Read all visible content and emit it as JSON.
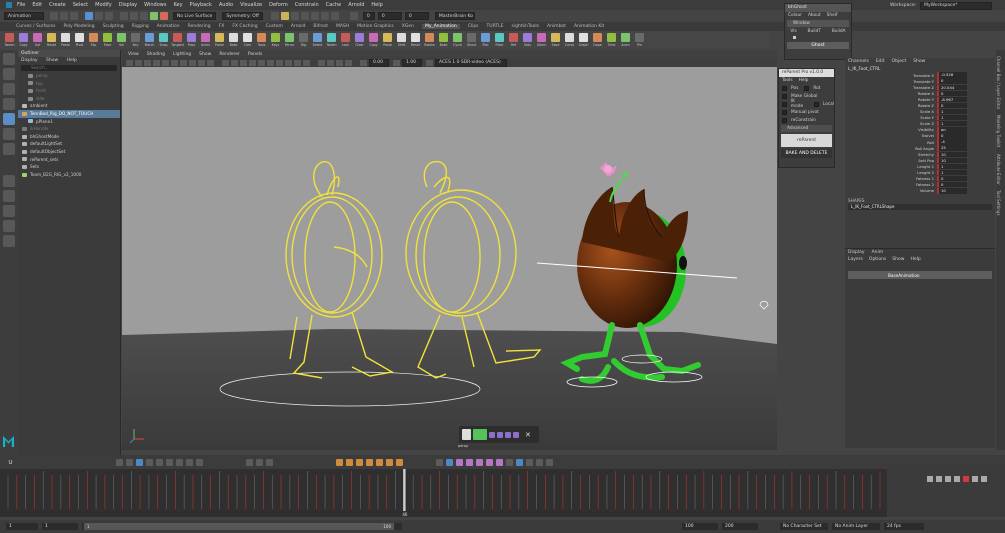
{
  "menubar": {
    "items": [
      "File",
      "Edit",
      "Create",
      "Select",
      "Modify",
      "Display",
      "Windows",
      "Key",
      "Playback",
      "Audio",
      "Visualize",
      "Deform",
      "Constrain",
      "Cache",
      "Arnold",
      "Help"
    ]
  },
  "statusline": {
    "mode": "Animation",
    "live_surface": "No Live Surface",
    "symmetry": "Symmetry: Off",
    "camera": "MasterBrain Ko",
    "frame_a": "0",
    "frame_b": "0",
    "frame_c": "0"
  },
  "workspace": {
    "label": "Workspace:",
    "value": "MyWorkspace*"
  },
  "shelf": {
    "tabs": [
      "Curves / Surfaces",
      "Poly Modeling",
      "Sculpting",
      "Rigging",
      "Animation",
      "Rendering",
      "FX",
      "FX Caching",
      "Custom",
      "Arnold",
      "Bifrost",
      "MASH",
      "Motion Graphics",
      "XGen",
      "My_Animation",
      "Clips",
      "TURTLE",
      "sightlinTools",
      "Animbot",
      "Animation Kit"
    ],
    "active_tab": "My_Animation",
    "buttons": [
      "Tween",
      "Copy",
      "Gof",
      "Reset",
      "Paste",
      "Pivot",
      "Flip",
      "Pose",
      "Sel",
      "Key",
      "Match",
      "Snap",
      "Tangent",
      "Pose",
      "Animi",
      "Polish",
      "Bake",
      "Cam",
      "Tools",
      "Keys",
      "Mirror",
      "Rig",
      "Select",
      "Tween",
      "Lock",
      "Clear",
      "Copy",
      "Paste",
      "Shift",
      "Reset",
      "Rotate",
      "Bake",
      "Cycle",
      "Ghost",
      "Plot",
      "Filter",
      "Ref",
      "Sets",
      "Xform",
      "Save",
      "Curve",
      "Graph",
      "Dope",
      "Time",
      "Anim",
      "Pin"
    ]
  },
  "outliner": {
    "title": "Outliner",
    "menu": [
      "Display",
      "Show",
      "Help"
    ],
    "search_placeholder": "Search...",
    "items": [
      {
        "label": "persp",
        "dim": true,
        "color": "#8a8a8a"
      },
      {
        "label": "top",
        "dim": true,
        "color": "#8a8a8a"
      },
      {
        "label": "front",
        "dim": true,
        "color": "#8a8a8a"
      },
      {
        "label": "side",
        "dim": true,
        "color": "#8a8a8a"
      },
      {
        "label": "ambient",
        "dim": false,
        "color": "#b8b8b8"
      },
      {
        "label": "TennBod_Rig_DO_NOT_TOUCH",
        "dim": false,
        "color": "#d6a55a",
        "selected": true
      },
      {
        "label": "pPlane1",
        "dim": false,
        "color": "#8fbce0"
      },
      {
        "label": "ikHandle",
        "dim": true,
        "color": "#7a7a7a"
      },
      {
        "label": "bhGhostMode",
        "dim": false,
        "color": "#b0b0b0"
      },
      {
        "label": "defaultLightSet",
        "dim": false,
        "color": "#b0b0b0"
      },
      {
        "label": "defaultObjectSet",
        "dim": false,
        "color": "#b0b0b0"
      },
      {
        "label": "reParent_sets",
        "dim": false,
        "color": "#b0b0b0"
      },
      {
        "label": "Sets",
        "dim": false,
        "color": "#b0b0b0"
      },
      {
        "label": "Team_B2G_RIG_v2_1000",
        "dim": false,
        "color": "#9bd26b"
      }
    ]
  },
  "viewport": {
    "menu": [
      "View",
      "Shading",
      "Lighting",
      "Show",
      "Renderer",
      "Panels"
    ],
    "exposure": "0.00",
    "gamma": "1.00",
    "color_space": "ACES 1.0 SDR-video (ACES)",
    "camera_label": "persp"
  },
  "pose_widget": {
    "label": "persp"
  },
  "channel_box": {
    "menu": [
      "Channels",
      "Edit",
      "Object",
      "Show"
    ],
    "object": "L_IK_Foot_CTRL",
    "attrs": [
      {
        "name": "Translate X",
        "value": "-0.528"
      },
      {
        "name": "Translate Y",
        "value": "0"
      },
      {
        "name": "Translate Z",
        "value": "20.044"
      },
      {
        "name": "Rotate X",
        "value": "0"
      },
      {
        "name": "Rotate Y",
        "value": "-8.967"
      },
      {
        "name": "Rotate Z",
        "value": "0"
      },
      {
        "name": "Scale X",
        "value": "1"
      },
      {
        "name": "Scale Y",
        "value": "1"
      },
      {
        "name": "Scale Z",
        "value": "1"
      },
      {
        "name": "Visibility",
        "value": "on"
      },
      {
        "name": "Swivel",
        "value": "0"
      },
      {
        "name": "Roll",
        "value": "-4"
      },
      {
        "name": "Roll Angle",
        "value": "25"
      },
      {
        "name": "Stretchy",
        "value": "10"
      },
      {
        "name": "Anti Pop",
        "value": "10"
      },
      {
        "name": "Lenght 1",
        "value": "1"
      },
      {
        "name": "Lenght 2",
        "value": "1"
      },
      {
        "name": "Fatness 1",
        "value": "0"
      },
      {
        "name": "Fatness 2",
        "value": "0"
      },
      {
        "name": "Volume",
        "value": "10"
      }
    ],
    "shapes_label": "SHAPES",
    "shape": "L_IK_Foot_CTRLShape"
  },
  "layer_editor": {
    "tabs": [
      "Display",
      "Anim"
    ],
    "menu": [
      "Layers",
      "Options",
      "Show",
      "Help"
    ],
    "layer": "BaseAnimation"
  },
  "right_tabs": [
    "Channel Box / Layer Editor",
    "Modeling Toolkit",
    "Attribute Editor",
    "Tool Settings"
  ],
  "win_tools": {
    "title": "bhGhost",
    "menu": [
      "Colour",
      "About",
      "Shelf"
    ],
    "row": "Window",
    "buttons": [
      "Vis",
      "BuildT",
      "BuildA"
    ],
    "ghost": "Ghost"
  },
  "win_reparent": {
    "title": "reParent Pro v1.0.0",
    "menu": [
      "Tools",
      "Help"
    ],
    "options": [
      "Pos",
      "Rot",
      "Make Global",
      "IK mode",
      "Local",
      "Manual pivot",
      "reConstrain"
    ],
    "advanced": "Advanced",
    "reparent": "reParent",
    "bake": "BAKE AND DELETE"
  },
  "timeline": {
    "current_frame": "46",
    "start": "1",
    "end": "100"
  },
  "rangebar": {
    "start_field": "1",
    "start_field2": "1",
    "anim_start": "1",
    "range_end_label": "100",
    "end_field": "100",
    "end_field2": "200",
    "character_set": "No Character Set",
    "anim_layer": "No Anim Layer",
    "fps": "24 fps"
  }
}
